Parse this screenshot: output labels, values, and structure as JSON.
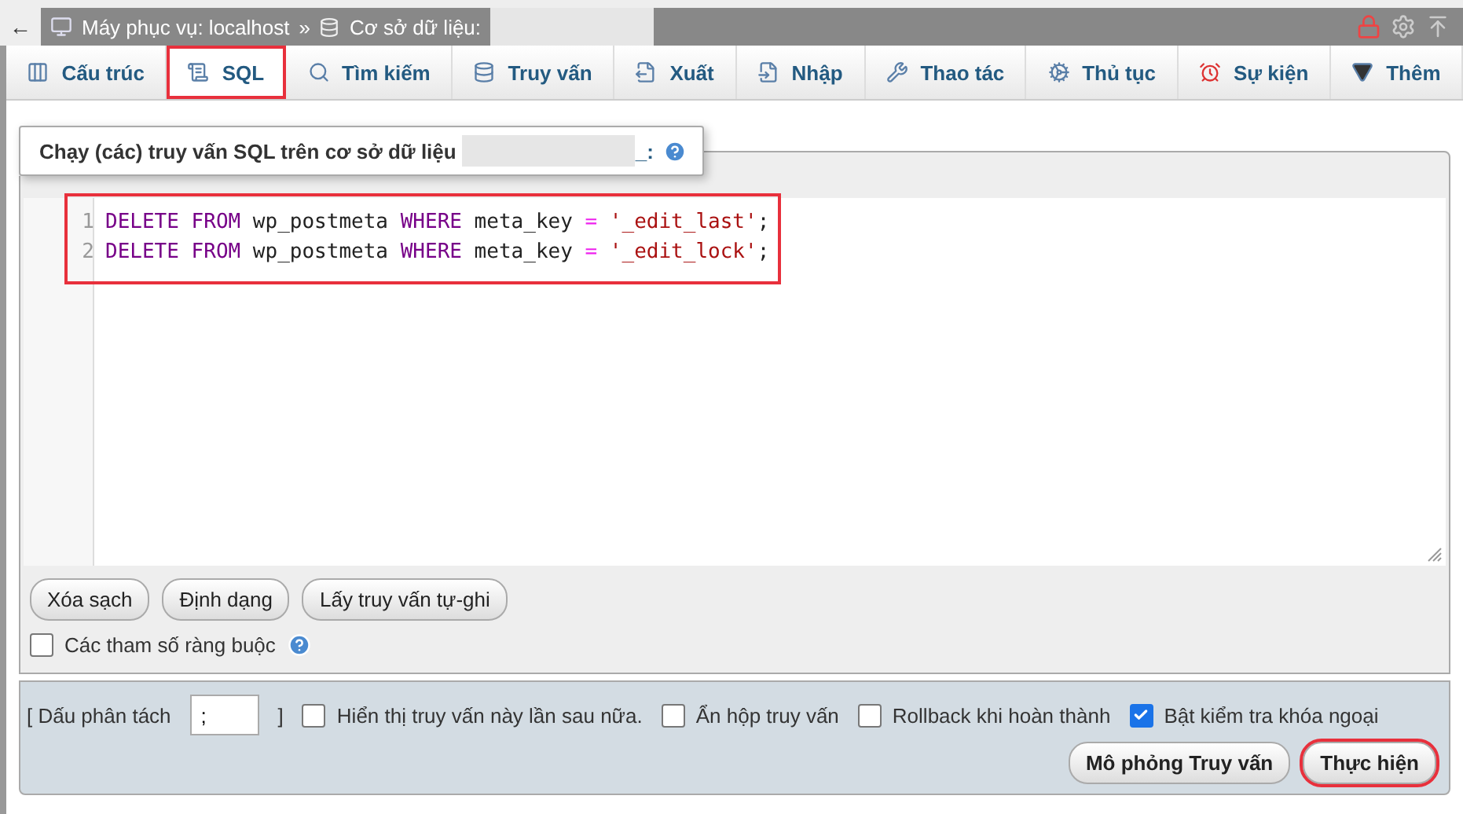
{
  "breadcrumb": {
    "back": "←",
    "server": "Máy phục vụ: localhost",
    "separator": "»",
    "database": "Cơ sở dữ liệu:"
  },
  "tabs": [
    {
      "label": "Cấu trúc",
      "selected": false,
      "highlighted": false
    },
    {
      "label": "SQL",
      "selected": true,
      "highlighted": true
    },
    {
      "label": "Tìm kiếm",
      "selected": false,
      "highlighted": false
    },
    {
      "label": "Truy vấn",
      "selected": false,
      "highlighted": false
    },
    {
      "label": "Xuất",
      "selected": false,
      "highlighted": false
    },
    {
      "label": "Nhập",
      "selected": false,
      "highlighted": false
    },
    {
      "label": "Thao tác",
      "selected": false,
      "highlighted": false
    },
    {
      "label": "Thủ tục",
      "selected": false,
      "highlighted": false
    },
    {
      "label": "Sự kiện",
      "selected": false,
      "highlighted": false
    },
    {
      "label": "Thêm",
      "selected": false,
      "highlighted": false
    }
  ],
  "legend": {
    "text": "Chạy (các) truy vấn SQL trên cơ sở dữ liệu",
    "suffix": "_:"
  },
  "editor": {
    "highlighted": true,
    "lines": [
      {
        "number": "1",
        "tokens": [
          {
            "kind": "keyword",
            "text": "DELETE FROM"
          },
          {
            "kind": "plain",
            "text": " wp_postmeta "
          },
          {
            "kind": "keyword",
            "text": "WHERE"
          },
          {
            "kind": "plain",
            "text": " meta_key "
          },
          {
            "kind": "operator",
            "text": "="
          },
          {
            "kind": "string",
            "text": " '_edit_last'"
          },
          {
            "kind": "plain",
            "text": ";"
          }
        ]
      },
      {
        "number": "2",
        "tokens": [
          {
            "kind": "keyword",
            "text": "DELETE FROM"
          },
          {
            "kind": "plain",
            "text": " wp_postmeta "
          },
          {
            "kind": "keyword",
            "text": "WHERE"
          },
          {
            "kind": "plain",
            "text": " meta_key "
          },
          {
            "kind": "operator",
            "text": "="
          },
          {
            "kind": "string",
            "text": " '_edit_lock'"
          },
          {
            "kind": "plain",
            "text": ";"
          }
        ]
      }
    ]
  },
  "editor_buttons": [
    "Xóa sạch",
    "Định dạng",
    "Lấy truy vấn tự-ghi"
  ],
  "bind_params": {
    "label": "Các tham số ràng buộc",
    "checked": false
  },
  "footer": {
    "delimiter_label": "[ Dấu phân tách",
    "delimiter_value": ";",
    "delimiter_close": "]",
    "options": [
      {
        "label": "Hiển thị truy vấn này lần sau nữa.",
        "checked": false
      },
      {
        "label": "Ẩn hộp truy vấn",
        "checked": false
      },
      {
        "label": "Rollback khi hoàn thành",
        "checked": false
      },
      {
        "label": "Bật kiểm tra khóa ngoại",
        "checked": true
      }
    ],
    "buttons": [
      {
        "label": "Mô phỏng Truy vấn",
        "highlighted": false
      },
      {
        "label": "Thực hiện",
        "highlighted": true
      }
    ]
  }
}
